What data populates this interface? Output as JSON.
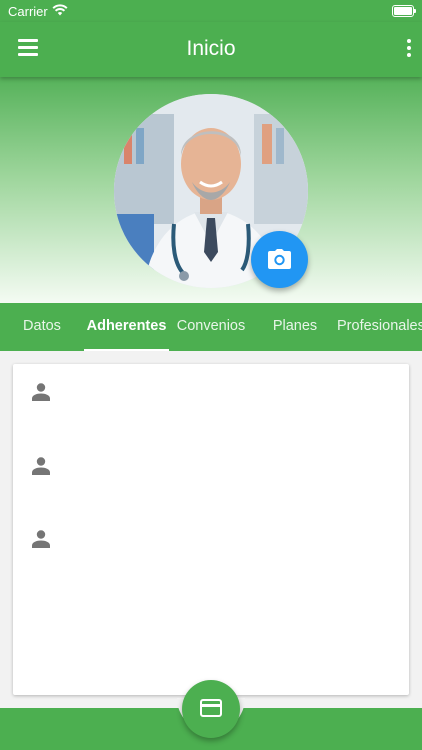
{
  "status_bar": {
    "carrier": "Carrier"
  },
  "app_bar": {
    "title": "Inicio"
  },
  "tabs": [
    {
      "label": "Datos"
    },
    {
      "label": "Adherentes",
      "active": true
    },
    {
      "label": "Convenios"
    },
    {
      "label": "Planes"
    },
    {
      "label": "Profesionales"
    }
  ],
  "list_items": [
    {
      "icon": "person-icon",
      "text": ""
    },
    {
      "icon": "person-icon",
      "text": ""
    },
    {
      "icon": "person-icon",
      "text": ""
    }
  ],
  "icons": {
    "menu": "menu-icon",
    "more": "more-vert-icon",
    "camera": "camera-icon",
    "card": "credit-card-icon",
    "wifi": "wifi-icon",
    "battery": "battery-icon"
  },
  "colors": {
    "primary": "#4caf50",
    "accent": "#2196f3",
    "background": "#f2f2f2"
  }
}
